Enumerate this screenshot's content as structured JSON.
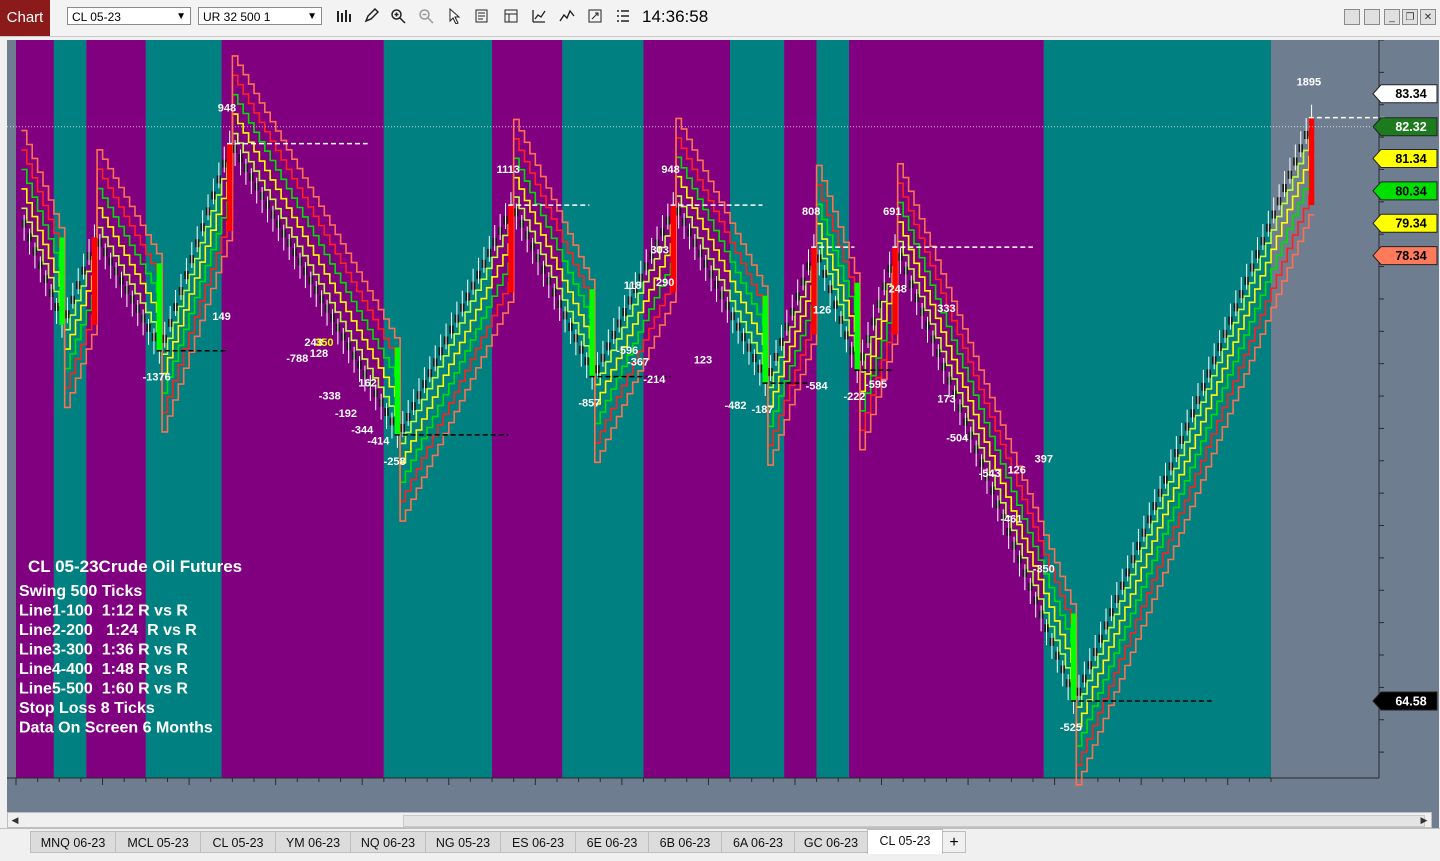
{
  "window": {
    "tab_label": "Chart",
    "instrument_selector": "CL 05-23",
    "bar_type_selector": "UR 32 500 1",
    "clock": "14:36:58"
  },
  "toolbar": {
    "icons": [
      "bars-icon",
      "pencil-icon",
      "zoom-in-icon",
      "zoom-out-icon",
      "cursor-icon",
      "properties-icon",
      "template-icon",
      "strategy-icon",
      "indicator-icon",
      "snapshot-icon",
      "data-box-icon"
    ]
  },
  "window_buttons": [
    "minimize",
    "maximize",
    "restore",
    "close"
  ],
  "colors": {
    "purple_session": "#800080",
    "teal_session": "#008080",
    "chart_background": "#6e7e90",
    "bull_candle": "#00ff00",
    "bear_candle": "#ff0000",
    "line_yellow": "#ffff00",
    "line_green": "#00e000",
    "line_red": "#ff2020",
    "line_salmon": "#ff7050",
    "line_lime": "#c0ff40"
  },
  "chart_data": {
    "type": "line",
    "instrument": "CL 05-23",
    "swing_points": [
      {
        "bar": 1,
        "price": 79.2,
        "label": ""
      },
      {
        "bar": 8,
        "price": 76.2,
        "label": ""
      },
      {
        "bar": 14,
        "price": 78.9,
        "label": ""
      },
      {
        "bar": 26,
        "price": 75.4,
        "label": "-1376"
      },
      {
        "bar": 39,
        "price": 81.8,
        "label": "948"
      },
      {
        "bar": 70,
        "price": 72.8,
        "label": "-258"
      },
      {
        "bar": 91,
        "price": 79.9,
        "label": "1113"
      },
      {
        "bar": 106,
        "price": 74.6,
        "label": "-857"
      },
      {
        "bar": 121,
        "price": 79.9,
        "label": "948"
      },
      {
        "bar": 138,
        "price": 74.4,
        "label": "-187"
      },
      {
        "bar": 147,
        "price": 78.6,
        "label": "808"
      },
      {
        "bar": 155,
        "price": 74.8,
        "label": "-222"
      },
      {
        "bar": 162,
        "price": 78.6,
        "label": "691"
      },
      {
        "bar": 195,
        "price": 64.58,
        "label": "-525"
      },
      {
        "bar": 239,
        "price": 82.6,
        "label": "1895"
      }
    ],
    "swing_labels": [
      {
        "bar": 38,
        "price": 76.35,
        "text": "149",
        "color": "white"
      },
      {
        "bar": 52,
        "price": 75.05,
        "text": "-788",
        "color": "white"
      },
      {
        "bar": 58,
        "price": 73.9,
        "text": "-338",
        "color": "white"
      },
      {
        "bar": 61,
        "price": 73.35,
        "text": "-192",
        "color": "white"
      },
      {
        "bar": 55,
        "price": 75.55,
        "text": "243",
        "color": "white"
      },
      {
        "bar": 56,
        "price": 75.2,
        "text": "128",
        "color": "white"
      },
      {
        "bar": 57,
        "price": 75.55,
        "text": "350",
        "color": "yellow"
      },
      {
        "bar": 65,
        "price": 74.3,
        "text": "162",
        "color": "white"
      },
      {
        "bar": 64,
        "price": 72.85,
        "text": "-344",
        "color": "white"
      },
      {
        "bar": 67,
        "price": 72.5,
        "text": "-414",
        "color": "white"
      },
      {
        "bar": 119,
        "price": 78.4,
        "text": "303",
        "color": "white"
      },
      {
        "bar": 114,
        "price": 77.3,
        "text": "118",
        "color": "white"
      },
      {
        "bar": 113,
        "price": 75.3,
        "text": "-596",
        "color": "white"
      },
      {
        "bar": 115,
        "price": 74.95,
        "text": "-367",
        "color": "white"
      },
      {
        "bar": 118,
        "price": 74.4,
        "text": "-214",
        "color": "white"
      },
      {
        "bar": 120,
        "price": 77.4,
        "text": "290",
        "color": "white"
      },
      {
        "bar": 127,
        "price": 75.0,
        "text": "123",
        "color": "white"
      },
      {
        "bar": 133,
        "price": 73.6,
        "text": "-482",
        "color": "white"
      },
      {
        "bar": 149,
        "price": 76.55,
        "text": "126",
        "color": "white"
      },
      {
        "bar": 148,
        "price": 74.2,
        "text": "-584",
        "color": "white"
      },
      {
        "bar": 159,
        "price": 74.25,
        "text": "-595",
        "color": "white"
      },
      {
        "bar": 163,
        "price": 77.2,
        "text": "248",
        "color": "white"
      },
      {
        "bar": 172,
        "price": 76.6,
        "text": "333",
        "color": "white"
      },
      {
        "bar": 172,
        "price": 73.8,
        "text": "173",
        "color": "white"
      },
      {
        "bar": 174,
        "price": 72.6,
        "text": "-504",
        "color": "white"
      },
      {
        "bar": 180,
        "price": 71.5,
        "text": "-543",
        "color": "white"
      },
      {
        "bar": 185,
        "price": 71.6,
        "text": "126",
        "color": "white"
      },
      {
        "bar": 190,
        "price": 71.95,
        "text": "397",
        "color": "white"
      },
      {
        "bar": 184,
        "price": 70.1,
        "text": "-461",
        "color": "white"
      },
      {
        "bar": 190,
        "price": 68.55,
        "text": "-350",
        "color": "white"
      }
    ],
    "sessions": [
      {
        "from": 0,
        "to": 7,
        "color": "purple"
      },
      {
        "from": 7,
        "to": 13,
        "color": "teal"
      },
      {
        "from": 13,
        "to": 24,
        "color": "purple"
      },
      {
        "from": 24,
        "to": 38,
        "color": "teal"
      },
      {
        "from": 38,
        "to": 68,
        "color": "purple"
      },
      {
        "from": 68,
        "to": 88,
        "color": "teal"
      },
      {
        "from": 88,
        "to": 101,
        "color": "purple"
      },
      {
        "from": 101,
        "to": 116,
        "color": "teal"
      },
      {
        "from": 116,
        "to": 132,
        "color": "purple"
      },
      {
        "from": 132,
        "to": 142,
        "color": "teal"
      },
      {
        "from": 142,
        "to": 148,
        "color": "purple"
      },
      {
        "from": 148,
        "to": 154,
        "color": "teal"
      },
      {
        "from": 154,
        "to": 190,
        "color": "purple"
      },
      {
        "from": 190,
        "to": 232,
        "color": "teal"
      }
    ],
    "total_bars": 232,
    "trail_offsets": [
      0.6,
      1.2,
      1.8,
      2.4,
      3.0
    ],
    "trail_colors": [
      "lime",
      "yellow",
      "green",
      "red",
      "salmon"
    ],
    "ylim": [
      62.2,
      85.0
    ],
    "price_markers": [
      {
        "value": "83.34",
        "bg": "#ffffff",
        "fg": "#000000"
      },
      {
        "value": "82.32",
        "bg": "#1e7a1e",
        "fg": "#ffffff"
      },
      {
        "value": "81.34",
        "bg": "#ffff00",
        "fg": "#000000"
      },
      {
        "value": "80.34",
        "bg": "#00e000",
        "fg": "#000000"
      },
      {
        "value": "79.34",
        "bg": "#ffff00",
        "fg": "#000000"
      },
      {
        "value": "78.34",
        "bg": "#ff7a5a",
        "fg": "#000000"
      },
      {
        "value": "64.58",
        "bg": "#000000",
        "fg": "#ffffff"
      }
    ],
    "annotations": {
      "title": "CL 05-23Crude Oil Futures",
      "lines": [
        "Swing 500 Ticks",
        "Line1-100  1:12 R vs R",
        "Line2-200   1:24  R vs R",
        "Line3-300  1:36 R vs R",
        "Line4-400  1:48 R vs R",
        "Line5-500  1:60 R vs R",
        "Stop Loss 8 Ticks",
        "Data On Screen 6 Months"
      ]
    }
  },
  "instrument_tabs": [
    {
      "label": "MNQ 06-23",
      "active": false
    },
    {
      "label": "MCL 05-23",
      "active": false
    },
    {
      "label": "CL 05-23",
      "active": false
    },
    {
      "label": "YM 06-23",
      "active": false
    },
    {
      "label": "NQ 06-23",
      "active": false
    },
    {
      "label": "NG 05-23",
      "active": false
    },
    {
      "label": "ES 06-23",
      "active": false
    },
    {
      "label": "6E 06-23",
      "active": false
    },
    {
      "label": "6B 06-23",
      "active": false
    },
    {
      "label": "6A 06-23",
      "active": false
    },
    {
      "label": "GC 06-23",
      "active": false
    },
    {
      "label": "CL 05-23",
      "active": true
    }
  ],
  "add_tab_label": "+"
}
